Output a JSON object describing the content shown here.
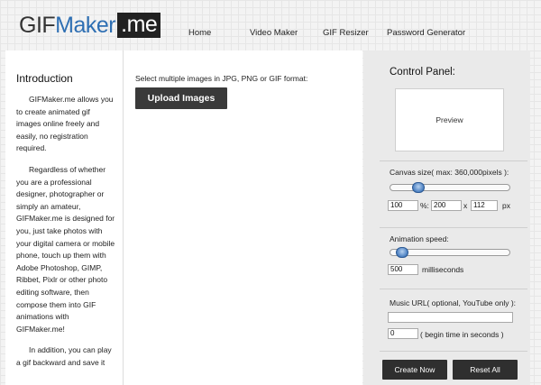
{
  "logo": {
    "gif": "GIF",
    "maker": "Maker",
    "me": ".me"
  },
  "nav": {
    "home": "Home",
    "video_maker": "Video Maker",
    "gif_resizer": "GIF Resizer",
    "password_generator": "Password Generator"
  },
  "sidebar": {
    "title": "Introduction",
    "para1": "GIFMaker.me allows you to create animated gif images online freely and easily, no registration required.",
    "para2": "Regardless of whether you are a professional designer, photographer or simply an amateur, GIFMaker.me is designed for you, just take photos with your digital camera or mobile phone, touch up them with Adobe Photoshop, GIMP, Ribbet, Pixlr or other photo editing software, then compose them into GIF animations with GIFMaker.me!",
    "para3": "In addition, you can play a gif backward and save it"
  },
  "upload": {
    "instructions": "Select multiple images in JPG, PNG or GIF format:",
    "button": "Upload Images"
  },
  "control_panel": {
    "title": "Control Panel:",
    "preview": "Preview",
    "canvas": {
      "label": "Canvas size( max: 360,000pixels ):",
      "percent": "100",
      "percent_unit": "%:",
      "width": "200",
      "x": "x",
      "height": "112",
      "px": "px",
      "slider_fraction": 0.2
    },
    "speed": {
      "label": "Animation speed:",
      "value": "500",
      "unit": "milliseconds",
      "slider_fraction": 0.05
    },
    "music": {
      "label": "Music URL( optional, YouTube only ):",
      "url": "",
      "begin": "0",
      "begin_label": "( begin time in seconds )"
    },
    "create_button": "Create Now",
    "reset_button": "Reset All"
  }
}
